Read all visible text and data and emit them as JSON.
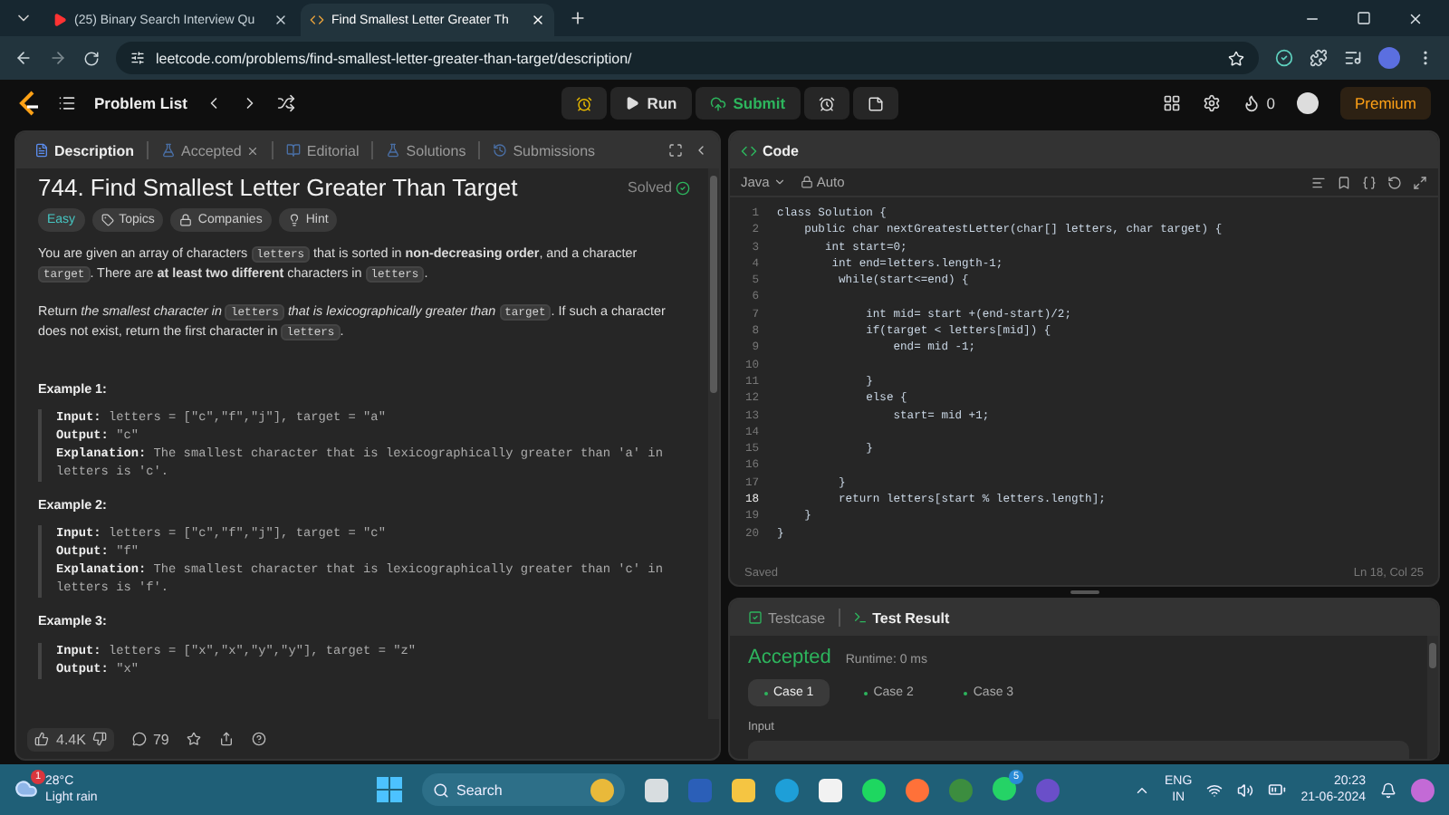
{
  "browser": {
    "tabs": [
      {
        "title": "(25) Binary Search Interview Qu",
        "selected": false
      },
      {
        "title": "Find Smallest Letter Greater Th",
        "selected": true
      }
    ],
    "url": "leetcode.com/problems/find-smallest-letter-greater-than-target/description/"
  },
  "nav": {
    "problem_list": "Problem List",
    "run": "Run",
    "submit": "Submit",
    "streak": "0",
    "premium": "Premium"
  },
  "left_tabs": [
    {
      "label": "Description",
      "selected": true,
      "closable": false
    },
    {
      "label": "Accepted",
      "selected": false,
      "closable": true
    },
    {
      "label": "Editorial",
      "selected": false,
      "closable": false
    },
    {
      "label": "Solutions",
      "selected": false,
      "closable": false
    },
    {
      "label": "Submissions",
      "selected": false,
      "closable": false
    }
  ],
  "problem": {
    "title": "744. Find Smallest Letter Greater Than Target",
    "status": "Solved",
    "tags": [
      {
        "label": "Easy",
        "kind": "difficulty"
      },
      {
        "label": "Topics",
        "kind": "topics"
      },
      {
        "label": "Companies",
        "kind": "companies"
      },
      {
        "label": "Hint",
        "kind": "hint"
      }
    ],
    "paragraphs": [
      [
        {
          "kind": "text",
          "text": "You are given an array of characters "
        },
        {
          "kind": "code",
          "text": "letters"
        },
        {
          "kind": "text",
          "text": " that is sorted in **non-decreasing order**, and a character "
        },
        {
          "kind": "code",
          "text": "target"
        },
        {
          "kind": "text",
          "text": ". There are **at least two different** characters in "
        },
        {
          "kind": "code",
          "text": "letters"
        },
        {
          "kind": "text",
          "text": "."
        }
      ],
      [
        {
          "kind": "text",
          "text": "Return *the smallest character in* "
        },
        {
          "kind": "code",
          "text": "letters"
        },
        {
          "kind": "text",
          "text": " *that is lexicographically greater than* "
        },
        {
          "kind": "code",
          "text": "target"
        },
        {
          "kind": "text",
          "text": ". If such a character does not exist, return the first character in "
        },
        {
          "kind": "code",
          "text": "letters"
        },
        {
          "kind": "text",
          "text": "."
        }
      ]
    ],
    "examples": [
      {
        "title": "Example 1:",
        "lines": [
          {
            "label": "Input:",
            "value": "letters = [\"c\",\"f\",\"j\"], target = \"a\""
          },
          {
            "label": "Output:",
            "value": "\"c\""
          },
          {
            "label": "Explanation:",
            "value": "The smallest character that is lexicographically greater than 'a' in letters is 'c'."
          }
        ]
      },
      {
        "title": "Example 2:",
        "lines": [
          {
            "label": "Input:",
            "value": "letters = [\"c\",\"f\",\"j\"], target = \"c\""
          },
          {
            "label": "Output:",
            "value": "\"f\""
          },
          {
            "label": "Explanation:",
            "value": "The smallest character that is lexicographically greater than 'c' in letters is 'f'."
          }
        ]
      },
      {
        "title": "Example 3:",
        "lines": [
          {
            "label": "Input:",
            "value": "letters = [\"x\",\"x\",\"y\",\"y\"], target = \"z\""
          },
          {
            "label": "Output:",
            "value": "\"x\""
          }
        ]
      }
    ]
  },
  "footer": {
    "likes": "4.4K",
    "comments": "79"
  },
  "editor": {
    "title": "Code",
    "language": "Java",
    "mode": "Auto",
    "status": "Saved",
    "cursor": "Ln 18, Col 25",
    "lines": [
      {
        "num": "1",
        "code": "class Solution {",
        "current": false
      },
      {
        "num": "2",
        "code": "    public char nextGreatestLetter(char[] letters, char target) {",
        "current": false
      },
      {
        "num": "3",
        "code": "       int start=0;",
        "current": false
      },
      {
        "num": "4",
        "code": "        int end=letters.length-1;",
        "current": false
      },
      {
        "num": "5",
        "code": "         while(start<=end) {",
        "current": false
      },
      {
        "num": "6",
        "current": false
      },
      {
        "num": "7",
        "code": "             int mid= start +(end-start)/2;",
        "current": false
      },
      {
        "num": "8",
        "code": "             if(target < letters[mid]) {",
        "current": false
      },
      {
        "num": "9",
        "code": "                 end= mid -1;",
        "current": false
      },
      {
        "num": "10",
        "current": false
      },
      {
        "num": "11",
        "code": "             }",
        "current": false
      },
      {
        "num": "12",
        "code": "             else {",
        "current": false
      },
      {
        "num": "13",
        "code": "                 start= mid +1;",
        "current": false
      },
      {
        "num": "14",
        "current": false
      },
      {
        "num": "15",
        "code": "             }",
        "current": false
      },
      {
        "num": "16",
        "current": false
      },
      {
        "num": "17",
        "code": "         }",
        "current": false
      },
      {
        "num": "18",
        "code": "         return letters[start % letters.length];",
        "current": true
      },
      {
        "num": "19",
        "code": "    }",
        "current": false
      },
      {
        "num": "20",
        "code": "}",
        "current": false
      }
    ]
  },
  "tests": {
    "tabs": [
      {
        "label": "Testcase",
        "selected": false
      },
      {
        "label": "Test Result",
        "selected": true
      }
    ],
    "verdict": "Accepted",
    "runtime": "Runtime: 0 ms",
    "cases": [
      {
        "label": "Case 1",
        "selected": true
      },
      {
        "label": "Case 2",
        "selected": false
      },
      {
        "label": "Case 3",
        "selected": false
      }
    ],
    "input_label": "Input"
  },
  "taskbar": {
    "weather_badge": "1",
    "temperature": "28°C",
    "condition": "Light rain",
    "search": "Search",
    "chat_badge": "5",
    "language": "ENG",
    "region": "IN",
    "time": "20:23",
    "date": "21-06-2024"
  }
}
